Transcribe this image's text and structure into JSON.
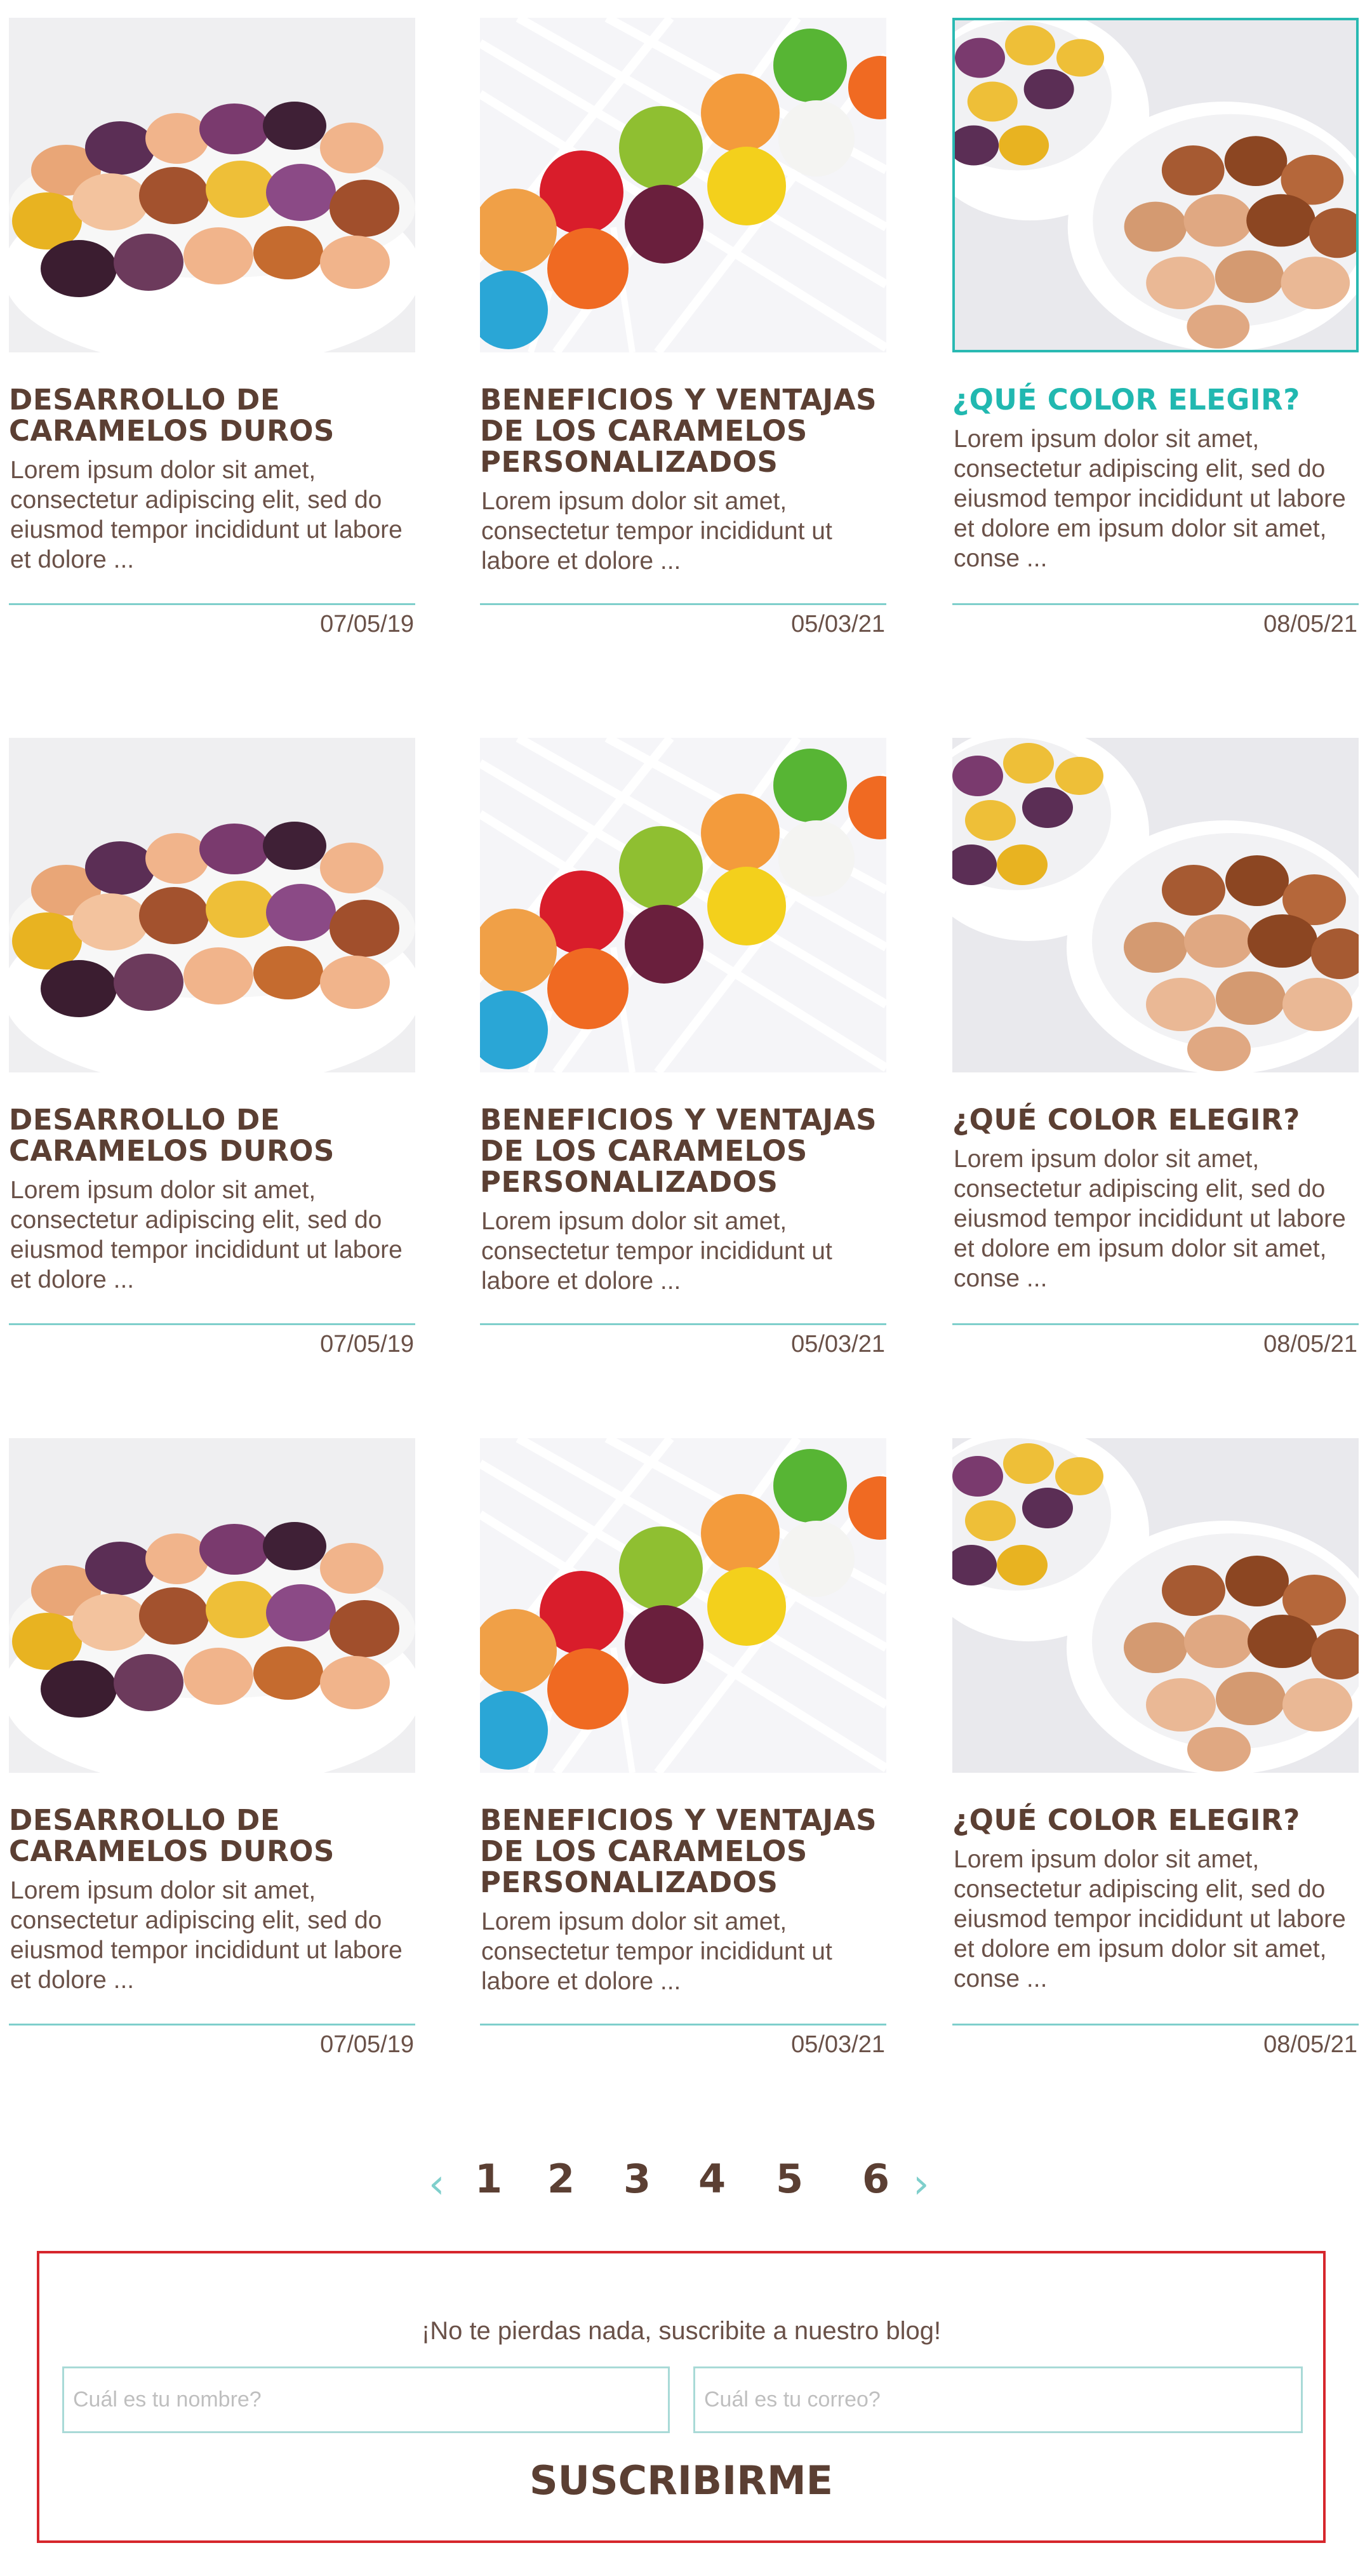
{
  "colors": {
    "brown": "#5b3f33",
    "teal": "#21b8b0",
    "separator": "#7fcfcc",
    "subscribe_border": "#d6262c"
  },
  "posts": [
    {
      "title": "DESARROLLO DE CARAMELOS DUROS",
      "excerpt": "Lorem ipsum dolor sit amet, consectetur adipiscing elit, sed do eiusmod tempor incididunt ut labore et dolore ...",
      "date": "07/05/19",
      "image": "candy-bowl-image"
    },
    {
      "title": "BENEFICIOS Y VENTAJAS DE LOS CARAMELOS PERSONALIZADOS",
      "excerpt": "Lorem ipsum dolor sit amet, consectetur  tempor incididunt ut labore et dolore ...",
      "date": "05/03/21",
      "image": "lollipops-image"
    },
    {
      "title": "¿QUÉ COLOR ELEGIR?",
      "excerpt": "Lorem ipsum dolor sit amet, consectetur adipiscing elit, sed do eiusmod tempor incididunt ut labore et dolore em ipsum dolor sit amet, conse ...",
      "date": "08/05/21",
      "image": "two-bowls-image"
    },
    {
      "title": "DESARROLLO DE CARAMELOS DUROS",
      "excerpt": "Lorem ipsum dolor sit amet, consectetur adipiscing elit, sed do eiusmod tempor incididunt ut labore et dolore ...",
      "date": "07/05/19",
      "image": "candy-bowl-image"
    },
    {
      "title": "BENEFICIOS Y VENTAJAS DE LOS CARAMELOS PERSONALIZADOS",
      "excerpt": "Lorem ipsum dolor sit amet, consectetur  tempor incididunt ut labore et dolore ...",
      "date": "05/03/21",
      "image": "lollipops-image"
    },
    {
      "title": "¿QUÉ COLOR ELEGIR?",
      "excerpt": "Lorem ipsum dolor sit amet, consectetur adipiscing elit, sed do eiusmod tempor incididunt ut labore et dolore em ipsum dolor sit amet, conse ...",
      "date": "08/05/21",
      "image": "two-bowls-image"
    },
    {
      "title": "DESARROLLO DE CARAMELOS DUROS",
      "excerpt": "Lorem ipsum dolor sit amet, consectetur adipiscing elit, sed do eiusmod tempor incididunt ut labore et dolore ...",
      "date": "07/05/19",
      "image": "candy-bowl-image"
    },
    {
      "title": "BENEFICIOS Y VENTAJAS DE LOS CARAMELOS PERSONALIZADOS",
      "excerpt": "Lorem ipsum dolor sit amet, consectetur  tempor incididunt ut labore et dolore ...",
      "date": "05/03/21",
      "image": "lollipops-image"
    },
    {
      "title": "¿QUÉ COLOR ELEGIR?",
      "excerpt": "Lorem ipsum dolor sit amet, consectetur adipiscing elit, sed do eiusmod tempor incididunt ut labore et dolore em ipsum dolor sit amet, conse ...",
      "date": "08/05/21",
      "image": "two-bowls-image"
    }
  ],
  "pagination": {
    "prev_icon": "chevron-left-icon",
    "next_icon": "chevron-right-icon",
    "pages": [
      "1",
      "2",
      "3",
      "4",
      "5",
      "6"
    ]
  },
  "subscribe": {
    "text": "¡No te pierdas nada, suscribite a nuestro blog!",
    "name_placeholder": "Cuál es tu nombre?",
    "email_placeholder": "Cuál es tu correo?",
    "button_label": "SUSCRIBIRME"
  }
}
